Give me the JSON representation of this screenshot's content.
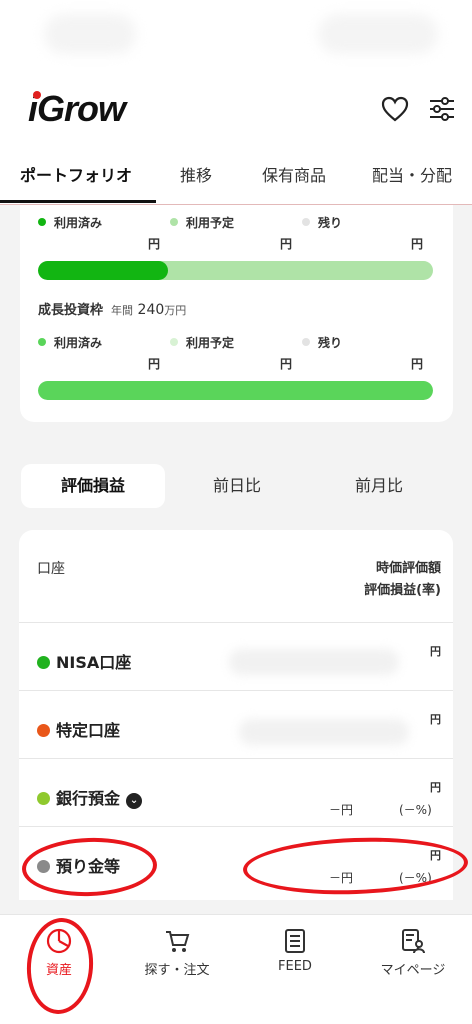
{
  "header": {
    "logo": "iGrow"
  },
  "tabs": [
    "ポートフォリオ",
    "推移",
    "保有商品",
    "配当・分配"
  ],
  "nisa_growth_section": {
    "legend": [
      "利用済み",
      "利用予定",
      "残り"
    ],
    "yen": [
      "円",
      "円",
      "円"
    ],
    "used_fraction": 0.33
  },
  "growth_section": {
    "title": "成長投資枠",
    "period": "年間",
    "amount": "240",
    "unit": "万円",
    "legend": [
      "利用済み",
      "利用予定",
      "残り"
    ],
    "yen": [
      "円",
      "円",
      "円"
    ],
    "used_fraction": 1.0
  },
  "segments": [
    "評価損益",
    "前日比",
    "前月比"
  ],
  "table": {
    "col_left": "口座",
    "col_right_1": "時価評価額",
    "col_right_2": "評価損益(率)",
    "rows": [
      {
        "name": "NISA口座",
        "yen": "円",
        "color": "#21b21f"
      },
      {
        "name": "特定口座",
        "yen": "円",
        "color": "#e9571a"
      },
      {
        "name": "銀行預金",
        "yen": "円",
        "color": "#8fc92e",
        "sub_val": "－円",
        "sub_pct": "(－%)"
      },
      {
        "name": "預り金等",
        "yen": "円",
        "color": "#8a8a8a",
        "sub_val": "－円",
        "sub_pct": "(－%)"
      }
    ]
  },
  "nav": [
    "資産",
    "探す・注文",
    "FEED",
    "マイページ"
  ],
  "colors": {
    "brand_red": "#e0201e",
    "green_dark": "#12b512",
    "green_light": "#afe3a7",
    "green_mid": "#5ad55a"
  }
}
